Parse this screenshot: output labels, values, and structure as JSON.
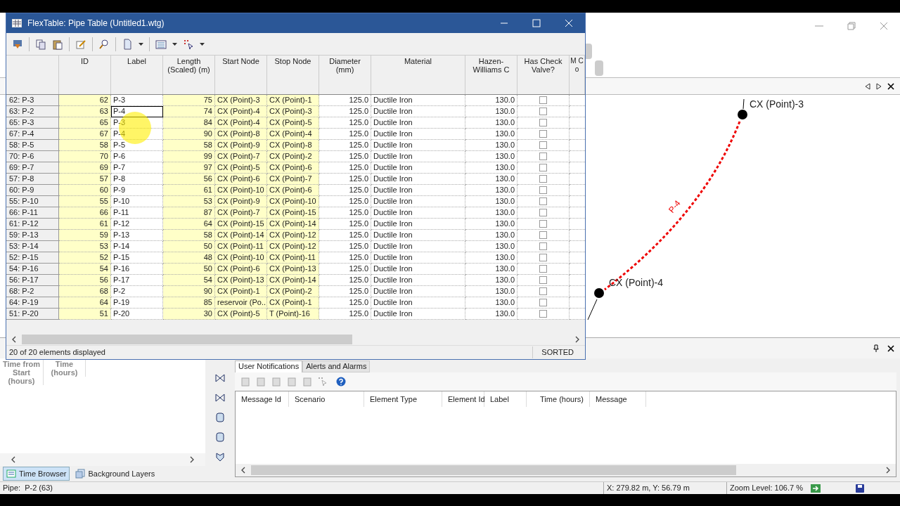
{
  "flextable": {
    "title": "FlexTable: Pipe Table (Untitled1.wtg)",
    "columns": [
      "ID",
      "Label",
      "Length (Scaled) (m)",
      "Start Node",
      "Stop Node",
      "Diameter (mm)",
      "Material",
      "Hazen-Williams C",
      "Has Check Valve?",
      "M Co"
    ],
    "rows": [
      {
        "header": "62: P-3",
        "cells": [
          "62",
          "P-3",
          "75",
          "CX (Point)-3",
          "CX (Point)-1",
          "125.0",
          "Ductile Iron",
          "130.0"
        ],
        "check_valve": false,
        "selected": false
      },
      {
        "header": "63: P-2",
        "cells": [
          "63",
          "P-4",
          "74",
          "CX (Point)-4",
          "CX (Point)-3",
          "125.0",
          "Ductile Iron",
          "130.0"
        ],
        "check_valve": false,
        "selected": true
      },
      {
        "header": "65: P-3",
        "cells": [
          "65",
          "P-3",
          "84",
          "CX (Point)-4",
          "CX (Point)-5",
          "125.0",
          "Ductile Iron",
          "130.0"
        ],
        "check_valve": false,
        "selected": false
      },
      {
        "header": "67: P-4",
        "cells": [
          "67",
          "P-4",
          "90",
          "CX (Point)-8",
          "CX (Point)-4",
          "125.0",
          "Ductile Iron",
          "130.0"
        ],
        "check_valve": false,
        "selected": false
      },
      {
        "header": "58: P-5",
        "cells": [
          "58",
          "P-5",
          "58",
          "CX (Point)-9",
          "CX (Point)-8",
          "125.0",
          "Ductile Iron",
          "130.0"
        ],
        "check_valve": false,
        "selected": false
      },
      {
        "header": "70: P-6",
        "cells": [
          "70",
          "P-6",
          "99",
          "CX (Point)-7",
          "CX (Point)-2",
          "125.0",
          "Ductile Iron",
          "130.0"
        ],
        "check_valve": false,
        "selected": false
      },
      {
        "header": "69: P-7",
        "cells": [
          "69",
          "P-7",
          "97",
          "CX (Point)-5",
          "CX (Point)-6",
          "125.0",
          "Ductile Iron",
          "130.0"
        ],
        "check_valve": false,
        "selected": false
      },
      {
        "header": "57: P-8",
        "cells": [
          "57",
          "P-8",
          "56",
          "CX (Point)-6",
          "CX (Point)-7",
          "125.0",
          "Ductile Iron",
          "130.0"
        ],
        "check_valve": false,
        "selected": false
      },
      {
        "header": "60: P-9",
        "cells": [
          "60",
          "P-9",
          "61",
          "CX (Point)-10",
          "CX (Point)-6",
          "125.0",
          "Ductile Iron",
          "130.0"
        ],
        "check_valve": false,
        "selected": false
      },
      {
        "header": "55: P-10",
        "cells": [
          "55",
          "P-10",
          "53",
          "CX (Point)-9",
          "CX (Point)-10",
          "125.0",
          "Ductile Iron",
          "130.0"
        ],
        "check_valve": false,
        "selected": false
      },
      {
        "header": "66: P-11",
        "cells": [
          "66",
          "P-11",
          "87",
          "CX (Point)-7",
          "CX (Point)-15",
          "125.0",
          "Ductile Iron",
          "130.0"
        ],
        "check_valve": false,
        "selected": false
      },
      {
        "header": "61: P-12",
        "cells": [
          "61",
          "P-12",
          "64",
          "CX (Point)-15",
          "CX (Point)-14",
          "125.0",
          "Ductile Iron",
          "130.0"
        ],
        "check_valve": false,
        "selected": false
      },
      {
        "header": "59: P-13",
        "cells": [
          "59",
          "P-13",
          "58",
          "CX (Point)-14",
          "CX (Point)-12",
          "125.0",
          "Ductile Iron",
          "130.0"
        ],
        "check_valve": false,
        "selected": false
      },
      {
        "header": "53: P-14",
        "cells": [
          "53",
          "P-14",
          "50",
          "CX (Point)-11",
          "CX (Point)-12",
          "125.0",
          "Ductile Iron",
          "130.0"
        ],
        "check_valve": false,
        "selected": false
      },
      {
        "header": "52: P-15",
        "cells": [
          "52",
          "P-15",
          "48",
          "CX (Point)-10",
          "CX (Point)-11",
          "125.0",
          "Ductile Iron",
          "130.0"
        ],
        "check_valve": false,
        "selected": false
      },
      {
        "header": "54: P-16",
        "cells": [
          "54",
          "P-16",
          "50",
          "CX (Point)-6",
          "CX (Point)-13",
          "125.0",
          "Ductile Iron",
          "130.0"
        ],
        "check_valve": false,
        "selected": false
      },
      {
        "header": "56: P-17",
        "cells": [
          "56",
          "P-17",
          "54",
          "CX (Point)-13",
          "CX (Point)-14",
          "125.0",
          "Ductile Iron",
          "130.0"
        ],
        "check_valve": false,
        "selected": false
      },
      {
        "header": "68: P-2",
        "cells": [
          "68",
          "P-2",
          "90",
          "CX (Point)-1",
          "CX (Point)-2",
          "125.0",
          "Ductile Iron",
          "130.0"
        ],
        "check_valve": false,
        "selected": false
      },
      {
        "header": "64: P-19",
        "cells": [
          "64",
          "P-19",
          "85",
          "reservoir (Po...",
          "CX (Point)-1",
          "125.0",
          "Ductile Iron",
          "130.0"
        ],
        "check_valve": false,
        "selected": false
      },
      {
        "header": "51: P-20",
        "cells": [
          "51",
          "P-20",
          "30",
          "CX (Point)-5",
          "T (Point)-16",
          "125.0",
          "Ductile Iron",
          "130.0"
        ],
        "check_valve": false,
        "selected": false
      }
    ],
    "status": "20 of 20 elements displayed",
    "sort_status": "SORTED"
  },
  "map": {
    "nodes": [
      "CX (Point)-3",
      "CX (Point)-4"
    ],
    "pipe_label": "P-4"
  },
  "time_browser": {
    "columns": [
      "Time from Start (hours)",
      "Time (hours)"
    ]
  },
  "notifications": {
    "tabs": [
      {
        "label": "User Notifications",
        "selected": true
      },
      {
        "label": "Alerts and Alarms",
        "selected": false
      }
    ],
    "columns": [
      "Message Id",
      "Scenario",
      "Element Type",
      "Element Id",
      "Label",
      "Time (hours)",
      "Message"
    ]
  },
  "bottom_tabs": [
    {
      "label": "Time Browser",
      "selected": true
    },
    {
      "label": "Background Layers",
      "selected": false
    }
  ],
  "status_bar": {
    "selection": "Pipe:  P-2 (63)",
    "coordinates": "X: 279.82 m, Y: 56.79 m",
    "zoom": "Zoom Level: 106.7 %"
  }
}
